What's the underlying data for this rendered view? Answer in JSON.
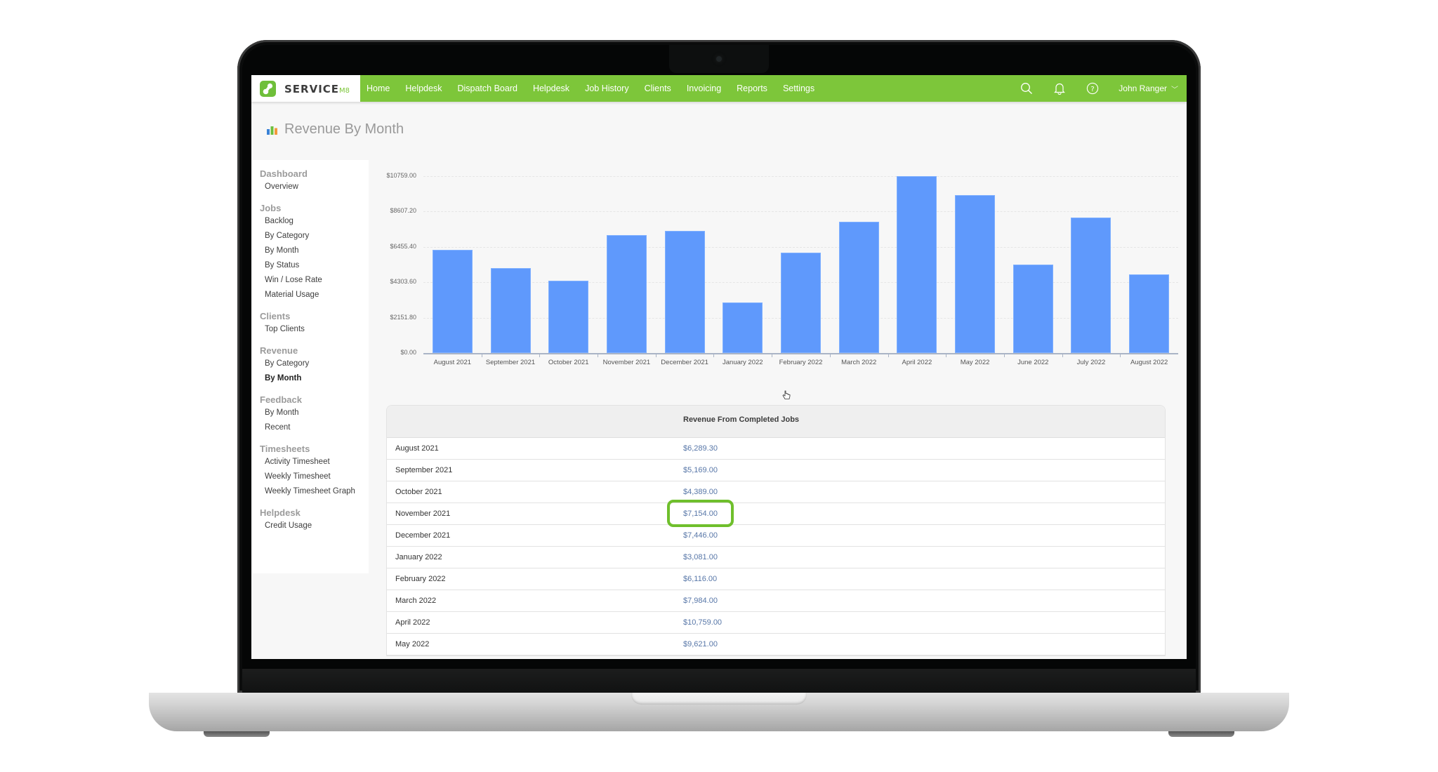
{
  "app": {
    "logo_text": "SERVICE",
    "logo_suffix": "M8"
  },
  "navbar": {
    "items": [
      "Home",
      "Helpdesk",
      "Dispatch Board",
      "Helpdesk",
      "Job History",
      "Clients",
      "Invoicing",
      "Reports",
      "Settings"
    ],
    "icons": [
      "search-icon",
      "bell-icon",
      "help-icon"
    ],
    "user_name": "John Ranger",
    "user_chevron": "﹀"
  },
  "page": {
    "title": "Revenue By Month"
  },
  "sidebar": {
    "groups": [
      {
        "title": "Dashboard",
        "items": [
          "Overview"
        ]
      },
      {
        "title": "Jobs",
        "items": [
          "Backlog",
          "By Category",
          "By Month",
          "By Status",
          "Win / Lose Rate",
          "Material Usage"
        ]
      },
      {
        "title": "Clients",
        "items": [
          "Top Clients"
        ]
      },
      {
        "title": "Revenue",
        "items": [
          "By Category",
          "By Month"
        ]
      },
      {
        "title": "Feedback",
        "items": [
          "By Month",
          "Recent"
        ]
      },
      {
        "title": "Timesheets",
        "items": [
          "Activity Timesheet",
          "Weekly Timesheet",
          "Weekly Timesheet Graph"
        ]
      },
      {
        "title": "Helpdesk",
        "items": [
          "Credit Usage"
        ]
      }
    ],
    "active": "Revenue/By Month"
  },
  "chart_data": {
    "type": "bar",
    "title": "",
    "xlabel": "",
    "ylabel": "",
    "categories": [
      "August 2021",
      "September 2021",
      "October 2021",
      "November 2021",
      "December 2021",
      "January 2022",
      "February 2022",
      "March 2022",
      "April 2022",
      "May 2022",
      "June 2022",
      "July 2022",
      "August 2022"
    ],
    "values": [
      6289.3,
      5169.0,
      4389.0,
      7154.0,
      7446.0,
      3081.0,
      6116.0,
      7984.0,
      10759.0,
      9621.0,
      5360.0,
      8230.0,
      4800.0
    ],
    "y_ticks": [
      "$0.00",
      "$2151.80",
      "$4303.60",
      "$6455.40",
      "$8607.20",
      "$10759.00"
    ],
    "ylim": [
      0,
      10759
    ],
    "grid": true,
    "bar_color": "#5f99fc",
    "legend": "none"
  },
  "table": {
    "header": "Revenue From Completed Jobs",
    "rows": [
      {
        "month": "August 2021",
        "amount": "$6,289.30"
      },
      {
        "month": "September 2021",
        "amount": "$5,169.00"
      },
      {
        "month": "October 2021",
        "amount": "$4,389.00"
      },
      {
        "month": "November 2021",
        "amount": "$7,154.00"
      },
      {
        "month": "December 2021",
        "amount": "$7,446.00"
      },
      {
        "month": "January 2022",
        "amount": "$3,081.00"
      },
      {
        "month": "February 2022",
        "amount": "$6,116.00"
      },
      {
        "month": "March 2022",
        "amount": "$7,984.00"
      },
      {
        "month": "April 2022",
        "amount": "$10,759.00"
      },
      {
        "month": "May 2022",
        "amount": "$9,621.00"
      }
    ],
    "highlighted_row": "November 2021"
  },
  "colors": {
    "brand_green": "#7dc63a",
    "link_blue": "#5877a8",
    "highlight_green": "#6fbf2c"
  }
}
